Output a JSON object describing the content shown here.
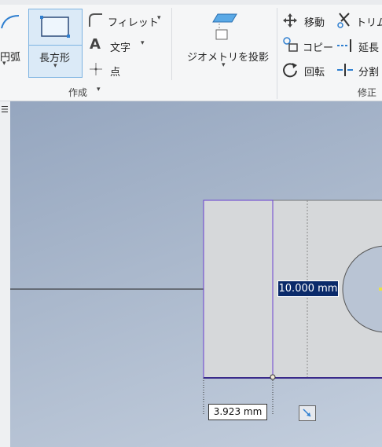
{
  "ribbon": {
    "arc_label": "円弧",
    "rectangle_label": "長方形",
    "fillet_label": "フィレット",
    "text_label": "文字",
    "point_label": "点",
    "project_geometry_label": "ジオメトリを投影",
    "create_group_label": "作成",
    "move_label": "移動",
    "trim_label": "トリム",
    "copy_label": "コピー",
    "extend_label": "延長",
    "rotate_label": "回転",
    "split_label": "分割",
    "modify_group_label": "修正"
  },
  "canvas": {
    "dimension_active": "10.000 mm",
    "dimension_width": "3.923 mm"
  },
  "colors": {
    "dimension_active_bg": "#0a2a6a",
    "sketch_purple": "#6a3fd0",
    "accent_blue": "#2f7fd0"
  }
}
